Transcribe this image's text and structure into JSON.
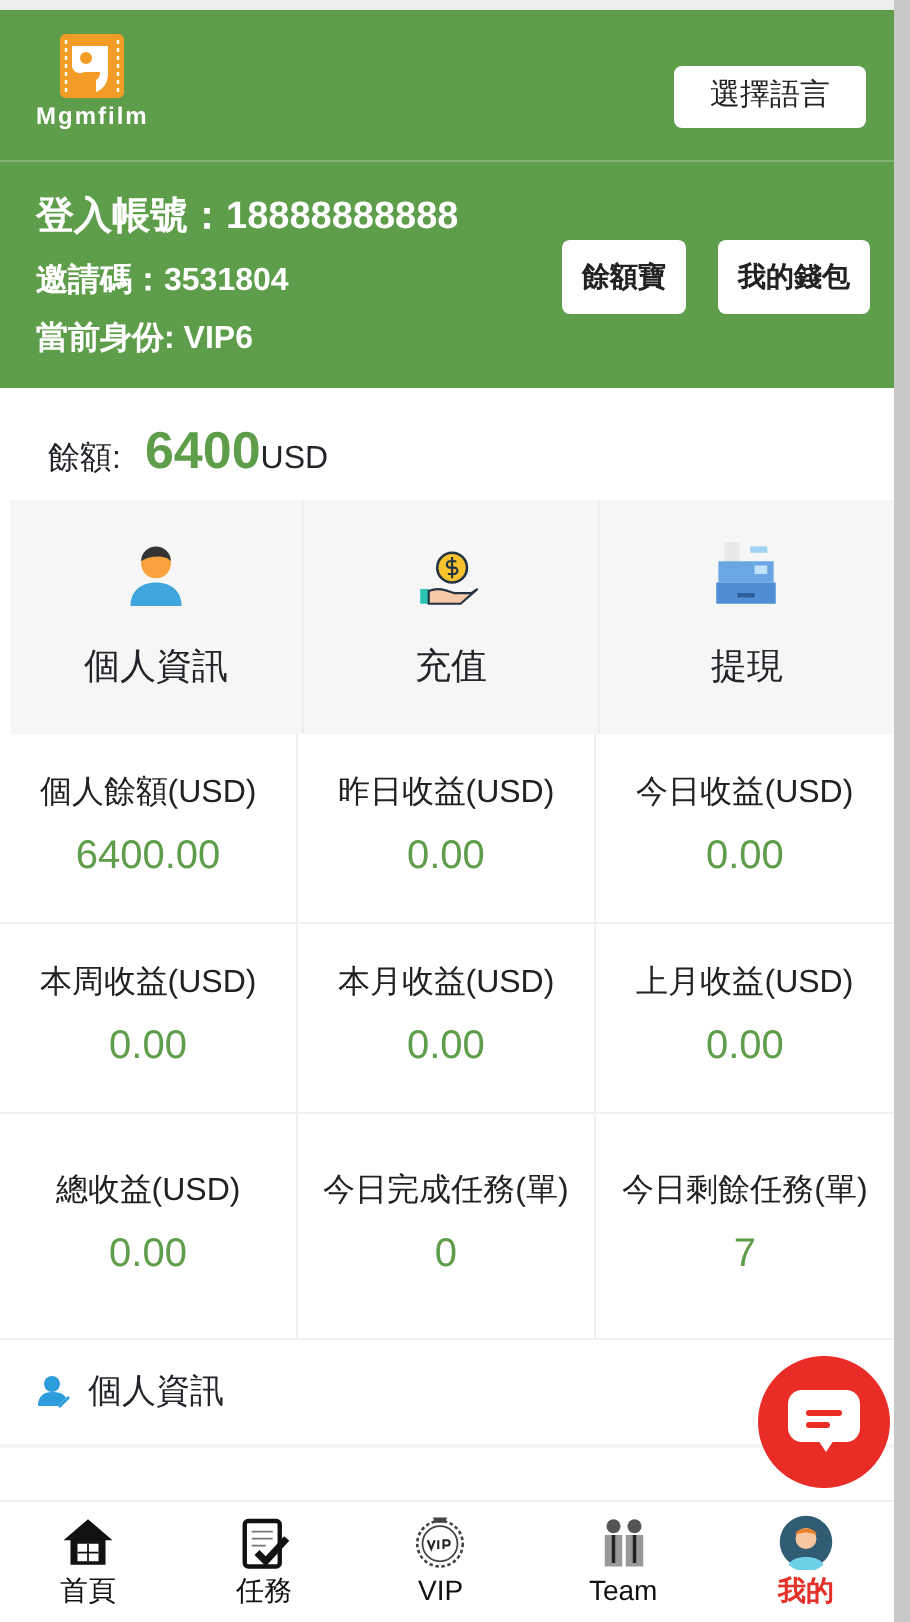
{
  "header": {
    "logo_text": "Mgmfilm",
    "language_button": "選擇語言",
    "account": "登入帳號：18888888888",
    "invite_code": "邀請碼：3531804",
    "identity": "當前身份: VIP6",
    "buttons": [
      "餘額寶",
      "我的錢包"
    ]
  },
  "balance": {
    "label": "餘額:",
    "amount": "6400",
    "currency": "USD"
  },
  "actions": [
    {
      "kind": "person",
      "label": "個人資訊"
    },
    {
      "kind": "recharge",
      "label": "充值"
    },
    {
      "kind": "withdraw",
      "label": "提現"
    }
  ],
  "stats": [
    {
      "label": "個人餘額(USD)",
      "value": "6400.00"
    },
    {
      "label": "昨日收益(USD)",
      "value": "0.00"
    },
    {
      "label": "今日收益(USD)",
      "value": "0.00"
    },
    {
      "label": "本周收益(USD)",
      "value": "0.00"
    },
    {
      "label": "本月收益(USD)",
      "value": "0.00"
    },
    {
      "label": "上月收益(USD)",
      "value": "0.00"
    },
    {
      "label": "總收益(USD)",
      "value": "0.00"
    },
    {
      "label": "今日完成任務(單)",
      "value": "0"
    },
    {
      "label": "今日剩餘任務(單)",
      "value": "7"
    }
  ],
  "menu": [
    {
      "kind": "profile",
      "label": "個人資訊"
    }
  ],
  "tabbar": [
    {
      "kind": "home",
      "label": "首頁",
      "selected": false
    },
    {
      "kind": "task",
      "label": "任務",
      "selected": false
    },
    {
      "kind": "vip",
      "label": "VIP",
      "selected": false
    },
    {
      "kind": "team",
      "label": "Team",
      "selected": false
    },
    {
      "kind": "me",
      "label": "我的",
      "selected": true
    }
  ]
}
